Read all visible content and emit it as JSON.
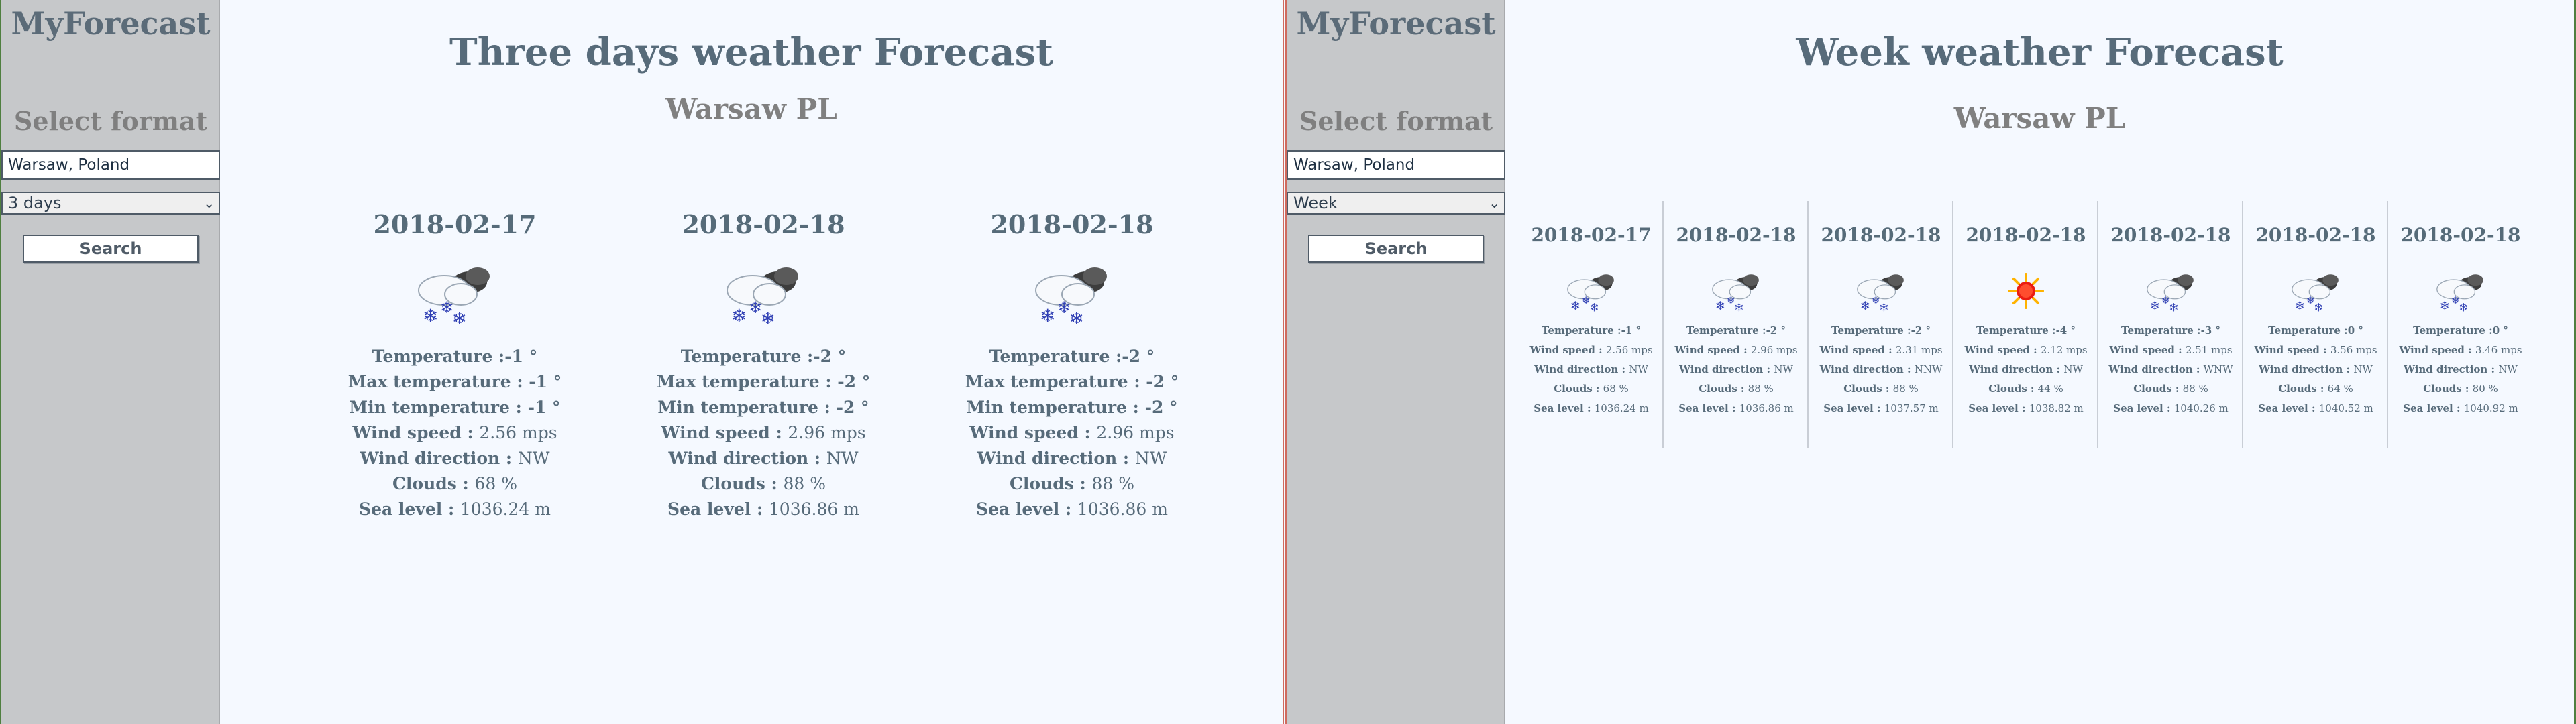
{
  "left": {
    "sidebar": {
      "brand": "MyForecast",
      "select_title": "Select format",
      "location_value": "Warsaw, Poland",
      "format_value": "3 days",
      "search_label": "Search"
    },
    "main": {
      "title": "Three days weather Forecast",
      "city": "Warsaw PL",
      "cards": [
        {
          "date": "2018-02-17",
          "icon": "snow-cloud-icon",
          "temperature": "-1 °",
          "max_temperature": "-1 °",
          "min_temperature": "-1 °",
          "wind_speed": "2.56 mps",
          "wind_direction": "NW",
          "clouds": "68 %",
          "sea_level": "1036.24 m"
        },
        {
          "date": "2018-02-18",
          "icon": "snow-cloud-icon",
          "temperature": "-2 °",
          "max_temperature": "-2 °",
          "min_temperature": "-2 °",
          "wind_speed": "2.96 mps",
          "wind_direction": "NW",
          "clouds": "88 %",
          "sea_level": "1036.86 m"
        },
        {
          "date": "2018-02-18",
          "icon": "snow-cloud-icon",
          "temperature": "-2 °",
          "max_temperature": "-2 °",
          "min_temperature": "-2 °",
          "wind_speed": "2.96 mps",
          "wind_direction": "NW",
          "clouds": "88 %",
          "sea_level": "1036.86 m"
        }
      ]
    }
  },
  "right": {
    "sidebar": {
      "brand": "MyForecast",
      "select_title": "Select format",
      "location_value": "Warsaw, Poland",
      "format_value": "Week",
      "search_label": "Search"
    },
    "main": {
      "title": "Week weather Forecast",
      "city": "Warsaw PL",
      "cards": [
        {
          "date": "2018-02-17",
          "icon": "snow-cloud-icon",
          "temperature": "-1 °",
          "wind_speed": "2.56 mps",
          "wind_direction": "NW",
          "clouds": "68 %",
          "sea_level": "1036.24 m"
        },
        {
          "date": "2018-02-18",
          "icon": "snow-cloud-icon",
          "temperature": "-2 °",
          "wind_speed": "2.96 mps",
          "wind_direction": "NW",
          "clouds": "88 %",
          "sea_level": "1036.86 m"
        },
        {
          "date": "2018-02-18",
          "icon": "snow-cloud-icon",
          "temperature": "-2 °",
          "wind_speed": "2.31 mps",
          "wind_direction": "NNW",
          "clouds": "88 %",
          "sea_level": "1037.57 m"
        },
        {
          "date": "2018-02-18",
          "icon": "sun-icon",
          "temperature": "-4 °",
          "wind_speed": "2.12 mps",
          "wind_direction": "NW",
          "clouds": "44 %",
          "sea_level": "1038.82 m"
        },
        {
          "date": "2018-02-18",
          "icon": "snow-cloud-icon",
          "temperature": "-3 °",
          "wind_speed": "2.51 mps",
          "wind_direction": "WNW",
          "clouds": "88 %",
          "sea_level": "1040.26 m"
        },
        {
          "date": "2018-02-18",
          "icon": "snow-cloud-icon",
          "temperature": "0 °",
          "wind_speed": "3.56 mps",
          "wind_direction": "NW",
          "clouds": "64 %",
          "sea_level": "1040.52 m"
        },
        {
          "date": "2018-02-18",
          "icon": "snow-cloud-icon",
          "temperature": "0 °",
          "wind_speed": "3.46 mps",
          "wind_direction": "NW",
          "clouds": "80 %",
          "sea_level": "1040.92 m"
        }
      ]
    }
  },
  "labels": {
    "temperature_3day": "Temperature :",
    "max_temperature": "Max temperature : ",
    "min_temperature": "Min temperature : ",
    "wind_speed": "Wind speed : ",
    "wind_direction": "Wind direction : ",
    "clouds": "Clouds : ",
    "sea_level": "Sea level : ",
    "temperature_week_a": "Temperature :",
    "temperature_week_b": "Temperature :"
  },
  "colors": {
    "sidebar_bg": "#c6c8ca",
    "page_bg": "#f5f9ff",
    "title_text": "#576b7a",
    "city_text": "#808080",
    "snow_flake": "#2f3fb4",
    "sun_red": "#ea1c12",
    "sun_orange": "#ffb300"
  }
}
